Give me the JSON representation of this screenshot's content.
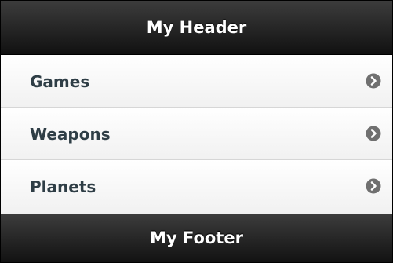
{
  "header": {
    "title": "My Header"
  },
  "list": {
    "items": [
      {
        "label": "Games",
        "icon": "chevron-right-icon"
      },
      {
        "label": "Weapons",
        "icon": "chevron-right-icon"
      },
      {
        "label": "Planets",
        "icon": "chevron-right-icon"
      }
    ]
  },
  "footer": {
    "title": "My Footer"
  },
  "colors": {
    "bar_background": "#1e1e1e",
    "bar_text": "#ffffff",
    "item_text": "#2f3e46",
    "chevron_circle": "#707070",
    "item_divider": "#d6d6d6"
  }
}
